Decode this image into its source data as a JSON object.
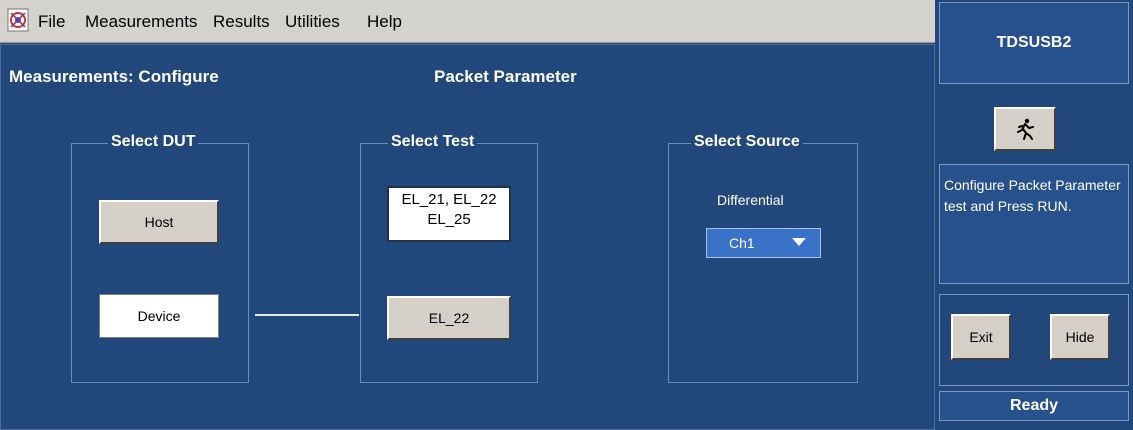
{
  "menu": {
    "items": [
      "File",
      "Measurements",
      "Results",
      "Utilities",
      "Help"
    ]
  },
  "main": {
    "title": "Measurements: Configure",
    "subtitle": "Packet Parameter",
    "select_dut": {
      "title": "Select DUT",
      "host_label": "Host",
      "device_label": "Device",
      "selected": "Device"
    },
    "select_test": {
      "title": "Select Test",
      "list_lines": [
        "EL_21, EL_22",
        "EL_25"
      ],
      "selected_button": "EL_22"
    },
    "select_source": {
      "title": "Select Source",
      "label": "Differential",
      "value": "Ch1"
    }
  },
  "side": {
    "product": "TDSUSB2",
    "run_icon": "running-man-icon",
    "message": "Configure  Packet Parameter test and Press RUN.",
    "exit_label": "Exit",
    "hide_label": "Hide",
    "status": "Ready"
  },
  "colors": {
    "panel_bg": "#22477a",
    "menubar_bg": "#d4d2cc",
    "button_face": "#d4d0c8",
    "dropdown_bg": "#3a72c8"
  }
}
